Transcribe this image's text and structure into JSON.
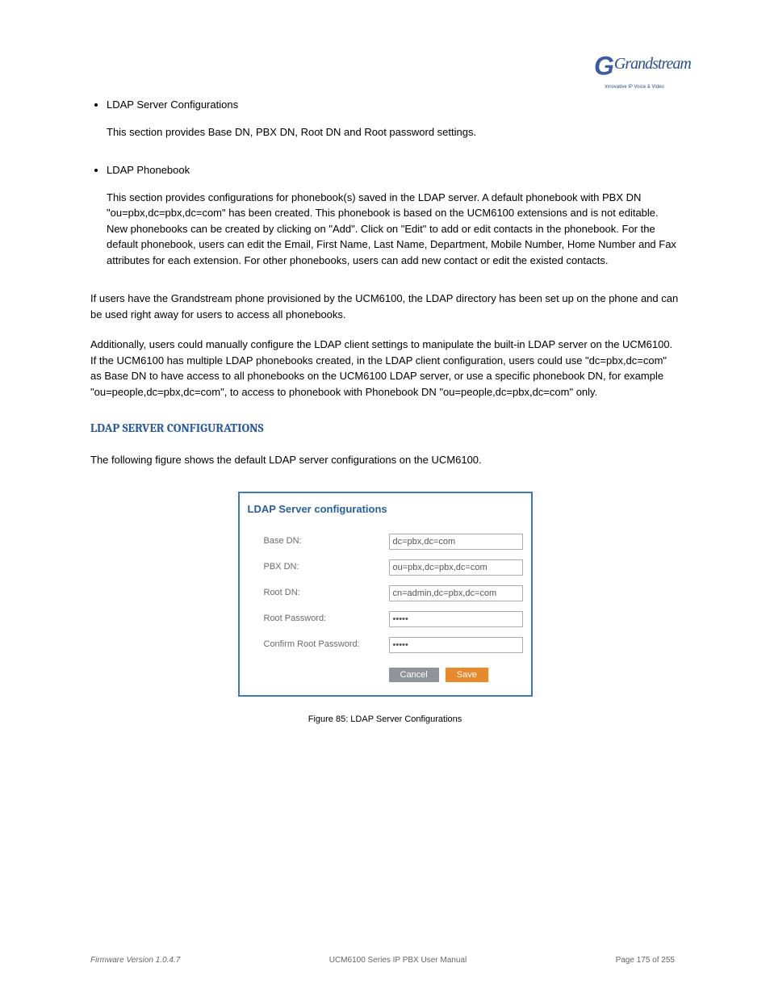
{
  "logo": {
    "text": "Grandstream",
    "tagline": "Innovative IP Voice & Video"
  },
  "bullets": [
    {
      "title": "LDAP Server Configurations",
      "sub": "This section provides Base DN, PBX DN, Root DN and Root password settings."
    },
    {
      "title": "LDAP Phonebook",
      "sub": "This section provides configurations for phonebook(s) saved in the LDAP server. A default phonebook with PBX DN \"ou=pbx,dc=pbx,dc=com\" has been created. This phonebook is based on the UCM6100 extensions and is not editable. New phonebooks can be created by clicking on \"Add\". Click on \"Edit\" to add or edit contacts in the phonebook. For the default phonebook, users can edit the Email, First Name, Last Name, Department, Mobile Number, Home Number and Fax attributes for each extension. For other phonebooks, users can add new contact or edit the existed contacts."
    }
  ],
  "note_paragraph": "If users have the Grandstream phone provisioned by the UCM6100, the LDAP directory has been set up on the phone and can be used right away for users to access all phonebooks.",
  "note_paragraph_2": "Additionally, users could manually configure the LDAP client settings to manipulate the built-in LDAP server on the UCM6100. If the UCM6100 has multiple LDAP phonebooks created, in the LDAP client configuration, users could use \"dc=pbx,dc=com\" as Base DN to have access to all phonebooks on the UCM6100 LDAP server, or use a specific phonebook DN, for example \"ou=people,dc=pbx,dc=com\", to access to phonebook with Phonebook DN \"ou=people,dc=pbx,dc=com\" only.",
  "section_heading": "LDAP SERVER CONFIGURATIONS",
  "section_desc": "The following figure shows the default LDAP server configurations on the UCM6100.",
  "dialog": {
    "title": "LDAP Server configurations",
    "fields": {
      "base_dn": {
        "label": "Base DN:",
        "value": "dc=pbx,dc=com"
      },
      "pbx_dn": {
        "label": "PBX DN:",
        "value": "ou=pbx,dc=pbx,dc=com"
      },
      "root_dn": {
        "label": "Root DN:",
        "value": "cn=admin,dc=pbx,dc=com"
      },
      "root_pw": {
        "label": "Root Password:",
        "value": "•••••"
      },
      "confirm_pw": {
        "label": "Confirm Root Password:",
        "value": "•••••"
      }
    },
    "buttons": {
      "cancel": "Cancel",
      "save": "Save"
    }
  },
  "figure_caption": "Figure 85: LDAP Server Configurations",
  "footer": {
    "firmware_line": "Firmware Version 1.0.4.7",
    "manual": "UCM6100 Series IP PBX User Manual",
    "page": "Page 175 of 255"
  }
}
